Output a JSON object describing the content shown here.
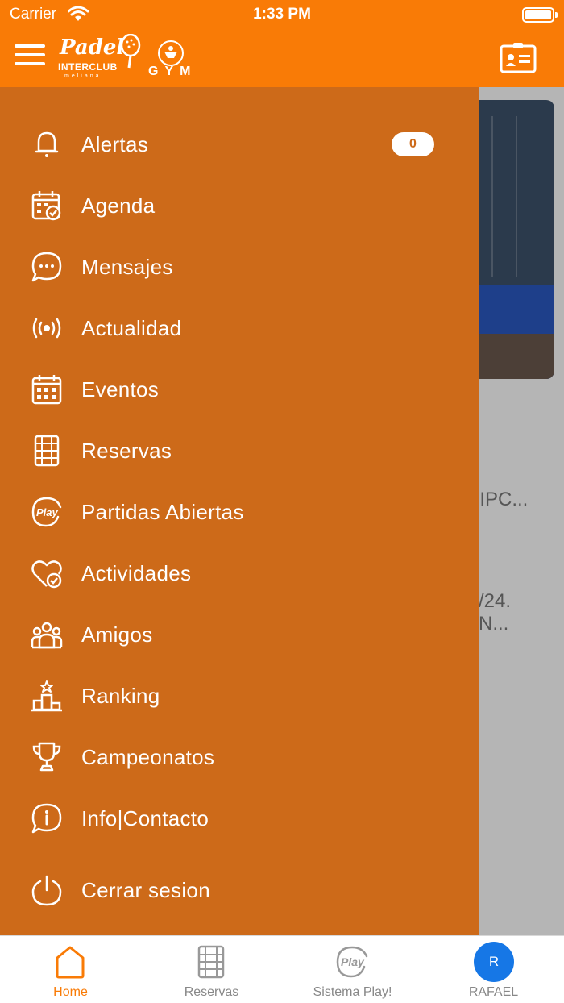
{
  "status_bar": {
    "carrier": "Carrier",
    "time": "1:33 PM"
  },
  "header": {
    "logo": {
      "padel": "Padel",
      "interclub": "INTERCLUB",
      "sub": "meliana",
      "gym": "GYM"
    }
  },
  "background": {
    "text1": "RIPC...",
    "text2": "/24.",
    "text3": "N..."
  },
  "drawer": {
    "items": [
      {
        "label": "Alertas",
        "icon": "bell-icon",
        "badge": "0"
      },
      {
        "label": "Agenda",
        "icon": "calendar-check-icon"
      },
      {
        "label": "Mensajes",
        "icon": "chat-bubble-icon"
      },
      {
        "label": "Actualidad",
        "icon": "broadcast-icon"
      },
      {
        "label": "Eventos",
        "icon": "calendar-grid-icon"
      },
      {
        "label": "Reservas",
        "icon": "court-icon"
      },
      {
        "label": "Partidas Abiertas",
        "icon": "play-icon"
      },
      {
        "label": "Actividades",
        "icon": "heart-check-icon"
      },
      {
        "label": "Amigos",
        "icon": "friends-icon"
      },
      {
        "label": "Ranking",
        "icon": "podium-icon"
      },
      {
        "label": "Campeonatos",
        "icon": "trophy-icon"
      },
      {
        "label": "Info|Contacto",
        "icon": "info-bubble-icon"
      },
      {
        "label": "Cerrar sesion",
        "icon": "power-icon"
      }
    ]
  },
  "tabbar": {
    "tabs": [
      {
        "label": "Home",
        "icon": "home-icon",
        "active": true
      },
      {
        "label": "Reservas",
        "icon": "court-icon"
      },
      {
        "label": "Sistema Play!",
        "icon": "play-icon"
      },
      {
        "label": "RAFAEL",
        "icon": "avatar",
        "initial": "R"
      }
    ]
  },
  "colors": {
    "header": "#f97b06",
    "drawer": "#cd6a19",
    "avatar": "#1677e6"
  }
}
